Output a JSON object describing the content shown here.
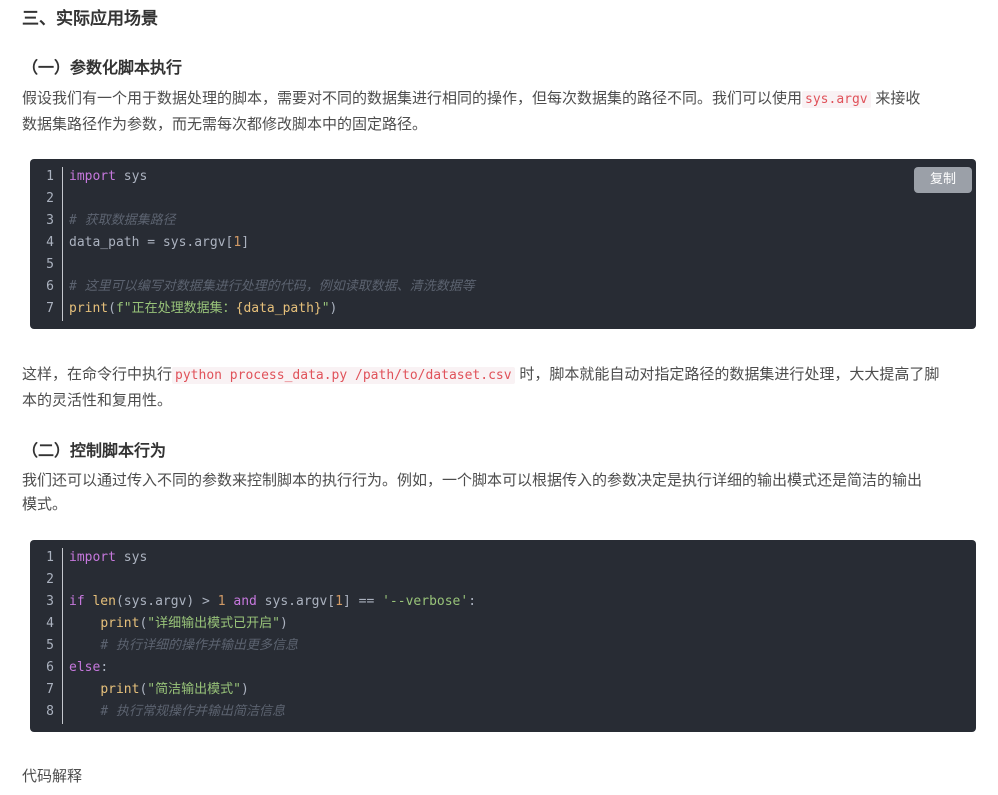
{
  "section_title": "三、实际应用场景",
  "sub1": {
    "title": "（一）参数化脚本执行",
    "para_a": "假设我们有一个用于数据处理的脚本，需要对不同的数据集进行相同的操作，但每次数据集的路径不同。我们可以使用",
    "inline_code": "sys.argv",
    "para_b": "来接收",
    "para_c": "数据集路径作为参数，而无需每次都修改脚本中的固定路径。",
    "copy_label": "复制",
    "code": {
      "line_numbers": [
        "1",
        "2",
        "3",
        "4",
        "5",
        "6",
        "7"
      ],
      "l1_kw": "import",
      "l1_rest": " sys",
      "l3": "# 获取数据集路径",
      "l4_a": "data_path = sys.argv[",
      "l4_num": "1",
      "l4_b": "]",
      "l6": "# 这里可以编写对数据集进行处理的代码，例如读取数据、清洗数据等",
      "l7_fn": "print",
      "l7_a": "(",
      "l7_str": "f\"正在处理数据集：",
      "l7_var": "{data_path}",
      "l7_str2": "\"",
      "l7_b": ")"
    }
  },
  "mid": {
    "a": "这样，在命令行中执行",
    "inline_code": "python process_data.py /path/to/dataset.csv",
    "b": "时，脚本就能自动对指定路径的数据集进行处理，大大提高了脚",
    "c": "本的灵活性和复用性。"
  },
  "sub2": {
    "title": "（二）控制脚本行为",
    "para_a": "我们还可以通过传入不同的参数来控制脚本的执行行为。例如，一个脚本可以根据传入的参数决定是执行详细的输出模式还是简洁的输出",
    "para_b": "模式。",
    "code": {
      "line_numbers": [
        "1",
        "2",
        "3",
        "4",
        "5",
        "6",
        "7",
        "8"
      ],
      "l1_kw": "import",
      "l1_rest": " sys",
      "l3_kw": "if",
      "l3_fn": "len",
      "l3_a": "(sys.argv) > ",
      "l3_num": "1",
      "l3_kw2": "and",
      "l3_b": " sys.argv[",
      "l3_num2": "1",
      "l3_c": "] == ",
      "l3_str": "'--verbose'",
      "l3_d": ":",
      "l4_fn": "print",
      "l4_str": "\"详细输出模式已开启\"",
      "l5": "# 执行详细的操作并输出更多信息",
      "l6_kw": "else",
      "l6_b": ":",
      "l7_fn": "print",
      "l7_str": "\"简洁输出模式\"",
      "l8": "# 执行常规操作并输出简洁信息"
    }
  },
  "footer_text": "代码解释"
}
